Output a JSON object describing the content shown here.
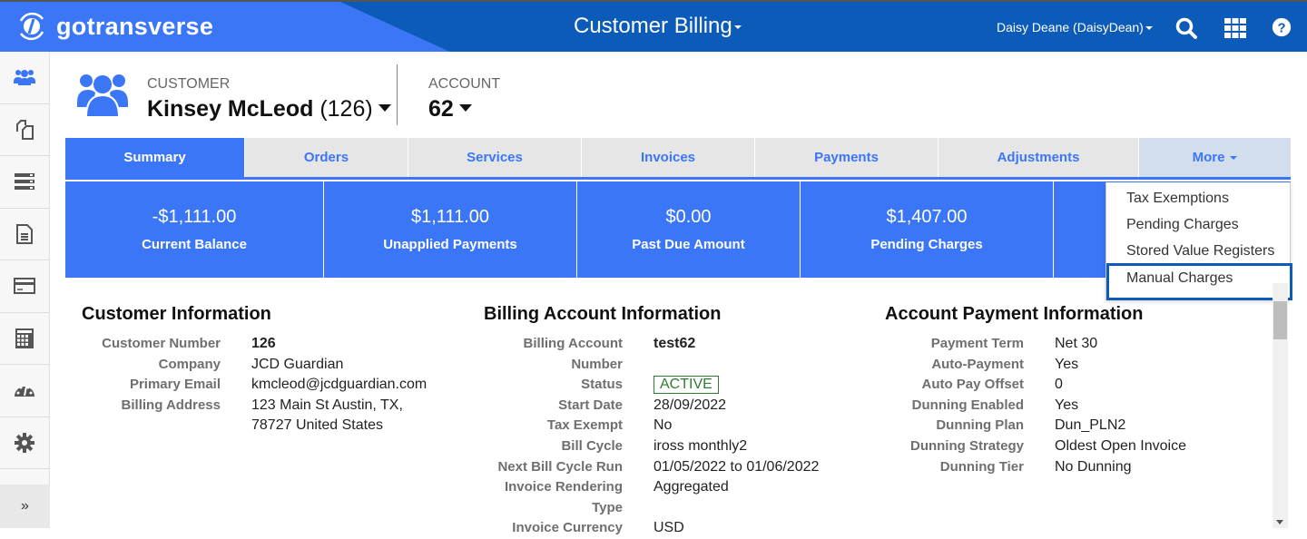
{
  "topbar": {
    "logo_text": "gotransverse",
    "app_title": "Customer Billing",
    "user": "Daisy Deane (DaisyDean)",
    "icons": [
      "search-icon",
      "apps-grid-icon",
      "help-icon"
    ]
  },
  "sidebar": {
    "items": [
      {
        "name": "customers",
        "icon": "users-icon",
        "active": true
      },
      {
        "name": "catalog",
        "icon": "copy-icon"
      },
      {
        "name": "services",
        "icon": "server-icon"
      },
      {
        "name": "documents",
        "icon": "document-icon"
      },
      {
        "name": "payments",
        "icon": "credit-card-icon"
      },
      {
        "name": "calculator",
        "icon": "calculator-icon"
      },
      {
        "name": "dashboard",
        "icon": "dashboard-icon"
      },
      {
        "name": "settings",
        "icon": "gear-icon"
      }
    ],
    "expand_label": "»"
  },
  "header": {
    "customer_label": "CUSTOMER",
    "customer_name": "Kinsey McLeod",
    "customer_id": "(126)",
    "account_label": "ACCOUNT",
    "account_number": "62"
  },
  "tabs": [
    {
      "label": "Summary",
      "active": true
    },
    {
      "label": "Orders"
    },
    {
      "label": "Services"
    },
    {
      "label": "Invoices"
    },
    {
      "label": "Payments"
    },
    {
      "label": "Adjustments"
    },
    {
      "label": "More"
    }
  ],
  "stats": [
    {
      "value": "-$1,111.00",
      "label": "Current Balance"
    },
    {
      "value": "$1,111.00",
      "label": "Unapplied Payments"
    },
    {
      "value": "$0.00",
      "label": "Past Due Amount"
    },
    {
      "value": "$1,407.00",
      "label": "Pending Charges"
    }
  ],
  "more_menu": {
    "items": [
      "Tax Exemptions",
      "Pending Charges",
      "Stored Value Registers",
      "Manual Charges"
    ],
    "highlighted": "Manual Charges"
  },
  "customer_info": {
    "title": "Customer Information",
    "rows": [
      {
        "label": "Customer Number",
        "value": "126"
      },
      {
        "label": "Company",
        "value": "JCD Guardian"
      },
      {
        "label": "Primary Email",
        "value": "kmcleod@jcdguardian.com"
      },
      {
        "label": "Billing Address",
        "value": "123 Main St Austin, TX,",
        "value2": "78727 United States"
      }
    ]
  },
  "billing_info": {
    "title": "Billing Account Information",
    "rows": [
      {
        "label": "Billing Account",
        "label2": "Number",
        "value": "test62"
      },
      {
        "label": "Status",
        "value": "ACTIVE"
      },
      {
        "label": "Start Date",
        "value": "28/09/2022"
      },
      {
        "label": "Tax Exempt",
        "value": "No"
      },
      {
        "label": "Bill Cycle",
        "value": "iross monthly2"
      },
      {
        "label": "Next Bill Cycle Run",
        "value": "01/05/2022 to 01/06/2022"
      },
      {
        "label": "Invoice Rendering",
        "label2": "Type",
        "value": "Aggregated"
      },
      {
        "label": "Invoice Currency",
        "value": "USD"
      }
    ]
  },
  "payment_info": {
    "title": "Account Payment Information",
    "rows": [
      {
        "label": "Payment Term",
        "value": "Net 30"
      },
      {
        "label": "Auto-Payment",
        "value": "Yes"
      },
      {
        "label": "Auto Pay Offset",
        "value": "0"
      },
      {
        "label": "Dunning Enabled",
        "value": "Yes"
      },
      {
        "label": "Dunning Plan",
        "value": "Dun_PLN2"
      },
      {
        "label": "Dunning Strategy",
        "value": "Oldest Open Invoice"
      },
      {
        "label": "Dunning Tier",
        "value": "No Dunning"
      }
    ]
  },
  "colors": {
    "brand_blue": "#3b76f6",
    "header_dark": "#0c5bb8",
    "active_green": "#2e7d32"
  }
}
